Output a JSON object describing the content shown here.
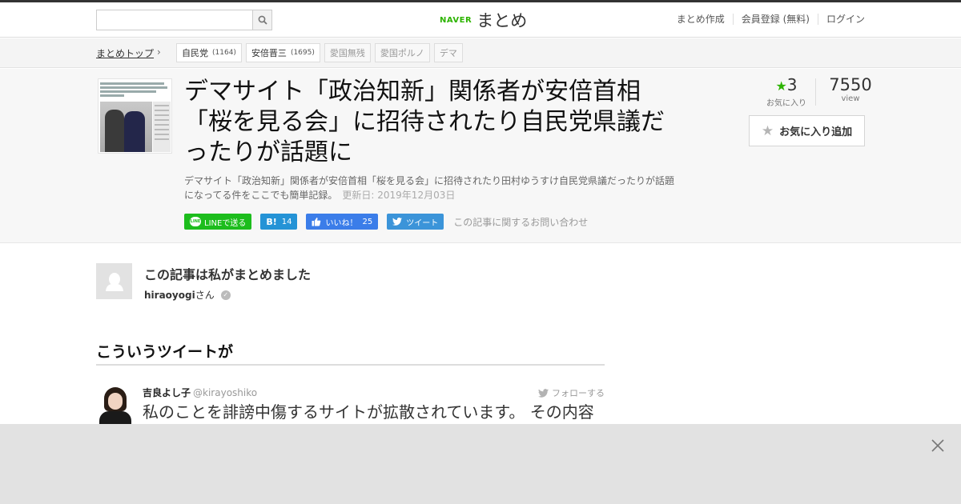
{
  "header": {
    "search_placeholder": "",
    "logo_brand": "NAVER",
    "logo_name": "まとめ",
    "nav": [
      "まとめ作成",
      "会員登録 (無料)",
      "ログイン"
    ]
  },
  "breadcrumb": {
    "top_label": "まとめトップ",
    "tags": [
      {
        "label": "自民党",
        "count": "(1164)"
      },
      {
        "label": "安倍晋三",
        "count": "(1695)"
      },
      {
        "label": "愛国無残",
        "count": ""
      },
      {
        "label": "愛国ポルノ",
        "count": ""
      },
      {
        "label": "デマ",
        "count": ""
      }
    ]
  },
  "article": {
    "title": "デマサイト「政治知新」関係者が安倍首相「桜を見る会」に招待されたり自民党県議だったりが話題に",
    "description": "デマサイト「政治知新」関係者が安倍首相「桜を見る会」に招待されたり田村ゆうすけ自民党県議だったりが話題になってる件をここでも簡単記録。",
    "updated": "更新日: 2019年12月03日",
    "share": {
      "line_label": "LINEで送る",
      "hatena_label": "B!",
      "hatena_count": "14",
      "like_label": "いいね！",
      "like_count": "25",
      "tweet_label": "ツイート",
      "contact_label": "この記事に関するお問い合わせ"
    },
    "stats": {
      "favorites": "3",
      "favorites_label": "お気に入り",
      "views": "7550",
      "views_label": "view"
    },
    "fav_button_label": "お気に入り追加"
  },
  "author": {
    "heading": "この記事は私がまとめました",
    "name": "hiraoyogi",
    "suffix": "さん"
  },
  "section": {
    "heading": "こういうツイートが"
  },
  "tweet": {
    "name": "吉良よし子",
    "handle": "@kirayoshiko",
    "follow_label": "フォローする",
    "text": "私のことを誹謗中傷するサイトが拡散されています。 その内容"
  },
  "colors": {
    "brand": "#2db400",
    "line": "#1dbd1d",
    "hatena": "#2493d6",
    "facebook": "#3b7de9",
    "twitter": "#3b94d9"
  }
}
